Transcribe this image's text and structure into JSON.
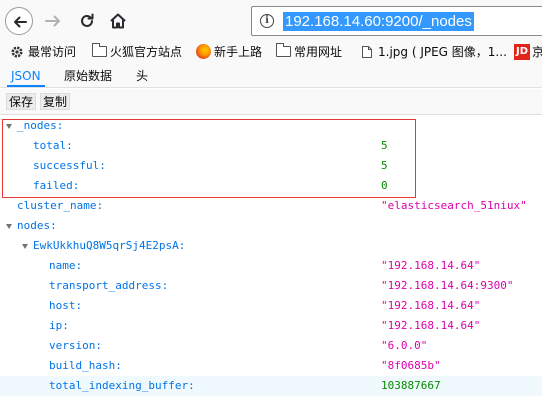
{
  "browser": {
    "url": "192.168.14.60:9200/_nodes",
    "bookmarks": [
      {
        "label": "最常访问",
        "icon": "gear-icon"
      },
      {
        "label": "火狐官方站点",
        "icon": "folder-icon"
      },
      {
        "label": "新手上路",
        "icon": "firefox-icon"
      },
      {
        "label": "常用网址",
        "icon": "folder-icon"
      },
      {
        "label": "1.jpg ( JPEG 图像，1...",
        "icon": "image-file-icon"
      },
      {
        "label": "京",
        "icon": "jd-icon"
      }
    ],
    "jd_icon_text": "JD"
  },
  "viewer": {
    "tabs": [
      {
        "label": "JSON",
        "active": true
      },
      {
        "label": "原始数据",
        "active": false
      },
      {
        "label": "头",
        "active": false
      }
    ],
    "toolbar": {
      "save_label": "保存",
      "copy_label": "复制"
    },
    "accent_color": "#0a84ff",
    "highlight_color": "#e53935"
  },
  "tree": {
    "nodes_key": "_nodes:",
    "total_key": "total:",
    "total_val": "5",
    "successful_key": "successful:",
    "successful_val": "5",
    "failed_key": "failed:",
    "failed_val": "0",
    "cluster_name_key": "cluster_name:",
    "cluster_name_val": "\"elasticsearch_51niux\"",
    "nodes_obj_key": "nodes:",
    "node_id_key": "EwkUkkhuQ8W5qrSj4E2psA:",
    "name_key": "name:",
    "name_val": "\"192.168.14.64\"",
    "transport_key": "transport_address:",
    "transport_val": "\"192.168.14.64:9300\"",
    "host_key": "host:",
    "host_val": "\"192.168.14.64\"",
    "ip_key": "ip:",
    "ip_val": "\"192.168.14.64\"",
    "version_key": "version:",
    "version_val": "\"6.0.0\"",
    "build_hash_key": "build_hash:",
    "build_hash_val": "\"8f0685b\"",
    "tib_key": "total_indexing_buffer:",
    "tib_val": "103887667"
  }
}
